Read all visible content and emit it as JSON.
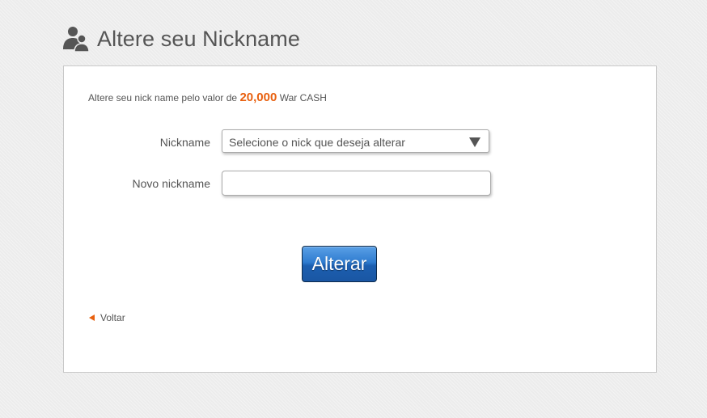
{
  "page": {
    "title": "Altere seu Nickname",
    "header_icon": "users-icon"
  },
  "form": {
    "price_prefix": "Altere seu nick name pelo valor de",
    "price_amount": "20,000",
    "price_suffix": "War CASH",
    "nickname_label": "Nickname",
    "nickname_select_value": "Selecione o nick que deseja alterar",
    "new_nickname_label": "Novo nickname",
    "new_nickname_value": "",
    "submit_label": "Alterar",
    "back_label": "Voltar",
    "back_icon": "triangle-left-icon"
  },
  "colors": {
    "accent": "#e8600f",
    "button_blue": "#2f7cd0",
    "text": "#555555",
    "background": "#ececec"
  }
}
